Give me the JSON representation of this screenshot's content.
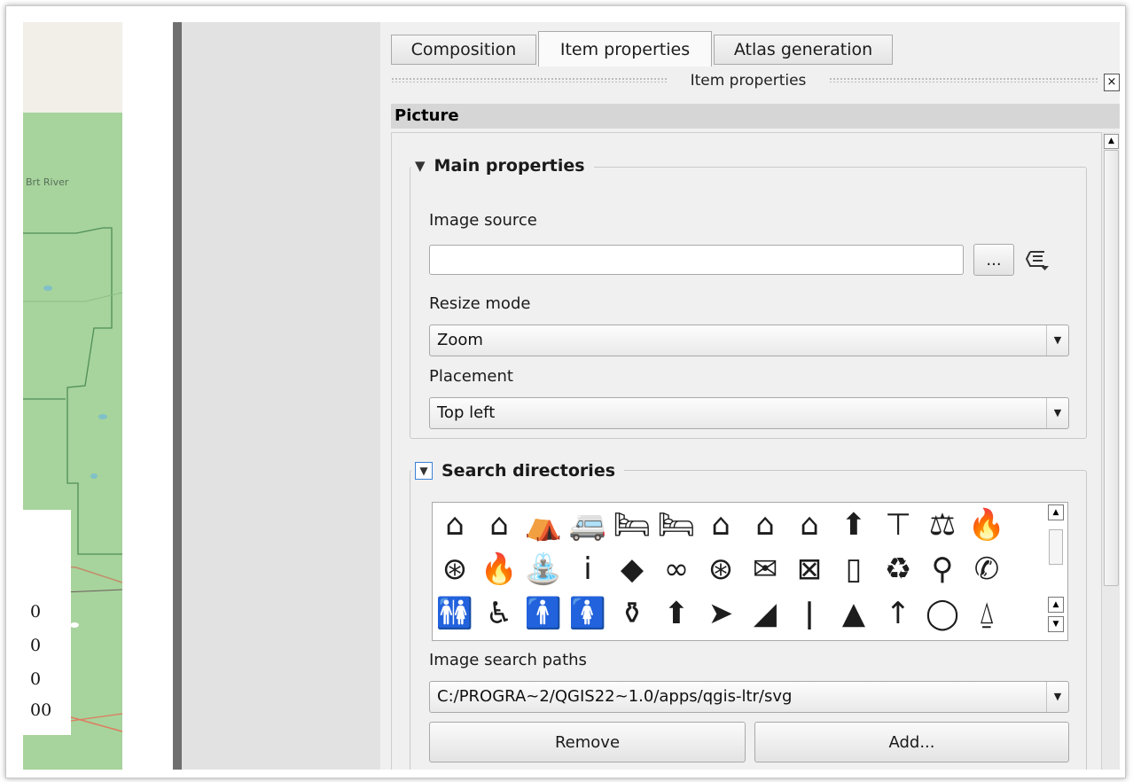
{
  "map": {
    "river_label": "Brt River",
    "scale_values": [
      "0",
      "0",
      "0",
      "00"
    ]
  },
  "tabs": [
    {
      "label": "Composition",
      "active": false
    },
    {
      "label": "Item properties",
      "active": true
    },
    {
      "label": "Atlas generation",
      "active": false
    }
  ],
  "dock": {
    "title": "Item properties",
    "close_glyph": "×"
  },
  "panel": {
    "header": "Picture"
  },
  "main_props": {
    "title": "Main properties",
    "image_source_label": "Image source",
    "image_source_value": "",
    "browse_label": "...",
    "resize_mode_label": "Resize mode",
    "resize_mode_value": "Zoom",
    "placement_label": "Placement",
    "placement_value": "Top left"
  },
  "search_dirs": {
    "title": "Search directories",
    "icons": [
      "⌂",
      "⌂",
      "⛺",
      "🚐",
      "🛏",
      "🛏",
      "⌂",
      "⌂",
      "⌂",
      "⬆",
      "⊤",
      "⚖",
      "🔥",
      "⊛",
      "🔥",
      "⛲",
      "i",
      "◆",
      "∞",
      "⊛",
      "✉",
      "⊠",
      "▯",
      "♻",
      "⚲",
      "✆",
      "🚻",
      "♿",
      "🚹",
      "🚺",
      "⚱",
      "⬆",
      "➤",
      "◢",
      "ǀ",
      "▲",
      "↑",
      "◯",
      "⍙"
    ],
    "search_paths_label": "Image search paths",
    "search_path_value": "C:/PROGRA~2/QGIS22~1.0/apps/qgis-ltr/svg",
    "remove_label": "Remove",
    "add_label": "Add..."
  },
  "colors": {
    "map_green": "#a7d39c",
    "focus_blue": "#3b82d6"
  }
}
